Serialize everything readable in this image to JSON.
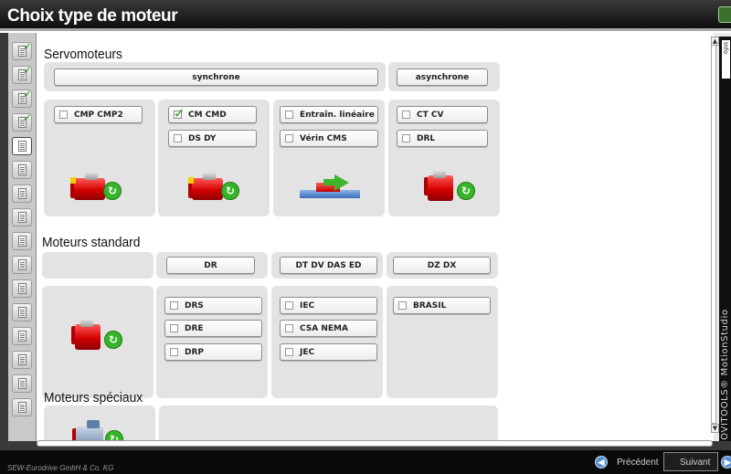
{
  "window": {
    "title": "Choix type de moteur"
  },
  "sidebar": {
    "items": [
      {
        "checked": true
      },
      {
        "checked": true
      },
      {
        "checked": true
      },
      {
        "checked": true
      },
      {
        "checked": false,
        "active": true
      },
      {
        "checked": false
      },
      {
        "checked": false
      },
      {
        "checked": false
      },
      {
        "checked": false
      },
      {
        "checked": false
      },
      {
        "checked": false
      },
      {
        "checked": false
      },
      {
        "checked": false
      },
      {
        "checked": false
      },
      {
        "checked": false
      },
      {
        "checked": false
      }
    ]
  },
  "servo": {
    "title": "Servomoteurs",
    "synchrone": "synchrone",
    "asynchrone": "asynchrone",
    "cmp": "CMP CMP2",
    "cm": "CM CMD",
    "cm_checked": true,
    "ds": "DS DY",
    "lineaire": "Entraîn. linéaire",
    "verin": "Vérin CMS",
    "ct": "CT CV",
    "drl": "DRL"
  },
  "standard": {
    "title": "Moteurs standard",
    "dr": "DR",
    "dt": "DT DV DAS ED",
    "dz": "DZ DX",
    "drs": "DRS",
    "dre": "DRE",
    "drp": "DRP",
    "iec": "IEC",
    "csa": "CSA NEMA",
    "jec": "JEC",
    "brasil": "BRASIL"
  },
  "special": {
    "title": "Moteurs spéciaux"
  },
  "side_text": "MOVITOOLS® MotionStudio",
  "side_top": "Info",
  "footer": {
    "copyright": "SEW-Eurodrive GmbH & Co. KG",
    "prev": "Précédent",
    "next": "Suivant"
  },
  "colors": {
    "check": "#2c9a1c",
    "motor": "#d40000",
    "arrow": "#36b52a"
  }
}
